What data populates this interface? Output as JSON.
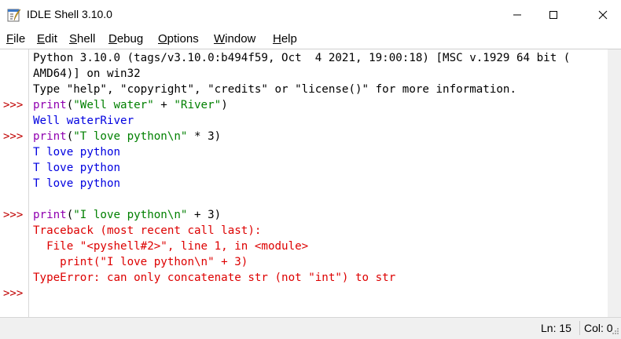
{
  "window": {
    "title": "IDLE Shell 3.10.0",
    "icon": "idle-feather-icon"
  },
  "menu": [
    {
      "label": "File",
      "accel": "F",
      "rest": "ile"
    },
    {
      "label": "Edit",
      "accel": "E",
      "rest": "dit"
    },
    {
      "label": "Shell",
      "accel": "S",
      "rest": "hell"
    },
    {
      "label": "Debug",
      "accel": "D",
      "rest": "ebug"
    },
    {
      "label": "Options",
      "accel": "O",
      "rest": "ptions"
    },
    {
      "label": "Window",
      "accel": "W",
      "rest": "indow"
    },
    {
      "label": "Help",
      "accel": "H",
      "rest": "elp"
    }
  ],
  "colors": {
    "prompt": "#c00000",
    "builtin": "#9000b0",
    "string": "#008000",
    "stdout": "#0000e0",
    "stderr": "#dd0000"
  },
  "shell": {
    "prompt": ">>>",
    "banner_1": "Python 3.10.0 (tags/v3.10.0:b494f59, Oct  4 2021, 19:00:18) [MSC v.1929 64 bit (",
    "banner_2": "AMD64)] on win32",
    "banner_3": "Type \"help\", \"copyright\", \"credits\" or \"license()\" for more information.",
    "cmd1_func": "print",
    "cmd1_open": "(",
    "cmd1_str1": "\"Well water\"",
    "cmd1_op": " + ",
    "cmd1_str2": "\"River\"",
    "cmd1_close": ")",
    "out1": "Well waterRiver",
    "cmd2_func": "print",
    "cmd2_open": "(",
    "cmd2_str": "\"T love python\\n\"",
    "cmd2_rest": " * 3)",
    "out2_1": "T love python",
    "out2_2": "T love python",
    "out2_3": "T love python",
    "cmd3_func": "print",
    "cmd3_open": "(",
    "cmd3_str": "\"I love python\\n\"",
    "cmd3_rest": " + 3)",
    "err_1": "Traceback (most recent call last):",
    "err_2": "  File \"<pyshell#2>\", line 1, in <module>",
    "err_3": "    print(\"I love python\\n\" + 3)",
    "err_4": "TypeError: can only concatenate str (not \"int\") to str"
  },
  "status": {
    "ln": "Ln: 15",
    "col": "Col: 0"
  }
}
